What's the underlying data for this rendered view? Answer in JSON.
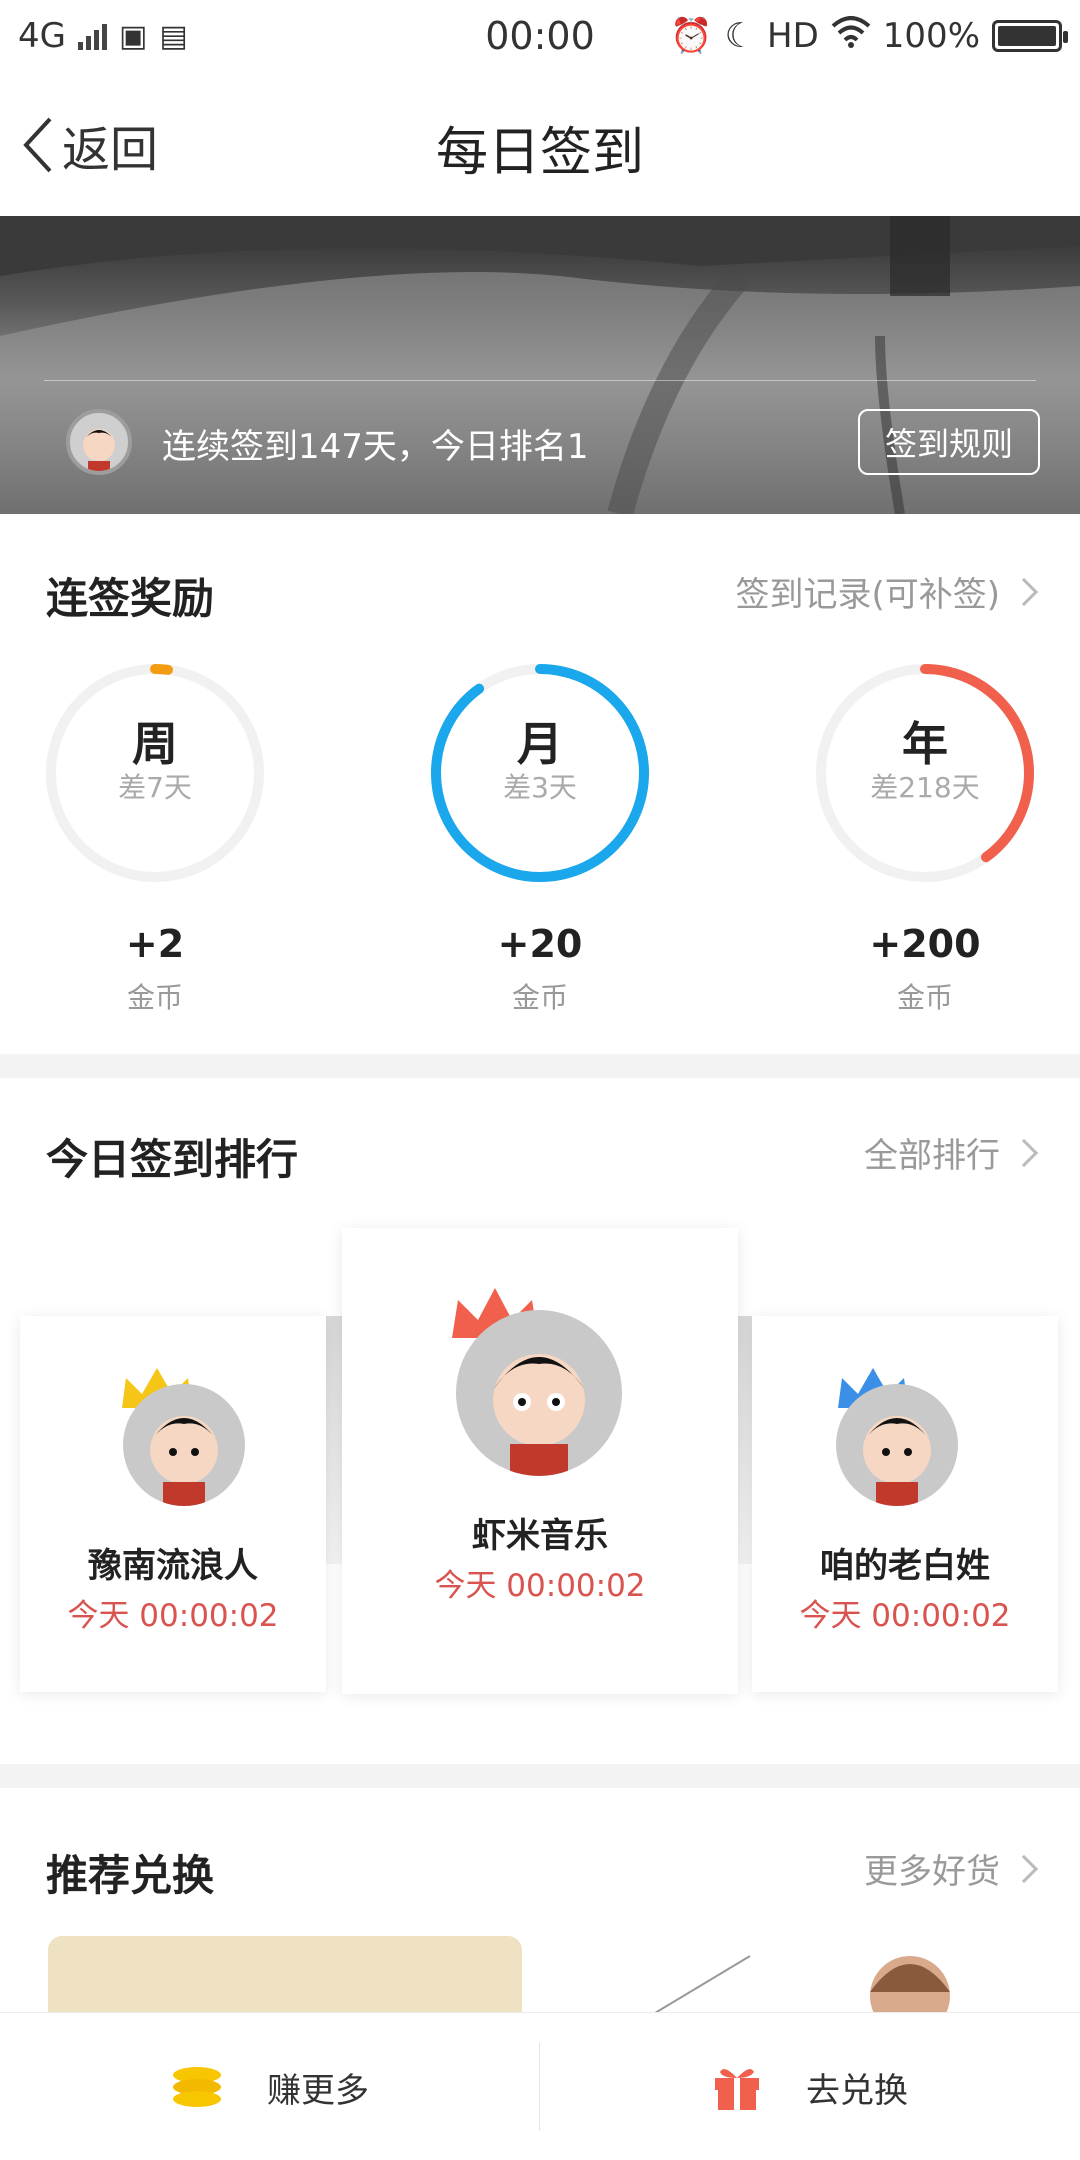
{
  "status_bar": {
    "network": "4G",
    "time": "00:00",
    "hd": "HD",
    "battery": "100%",
    "battery_level": 1.0
  },
  "nav": {
    "back_label": "返回",
    "title": "每日签到"
  },
  "banner": {
    "streak_text": "连续签到147天，今日排名1",
    "rules_button": "签到规则"
  },
  "rewards": {
    "title": "连签奖励",
    "link": "签到记录(可补签)",
    "items": [
      {
        "period": "周",
        "remaining": "差7天",
        "reward": "+2",
        "unit": "金币",
        "color": "#f39c12",
        "progress": 0.02
      },
      {
        "period": "月",
        "remaining": "差3天",
        "reward": "+20",
        "unit": "金币",
        "color": "#1aa7ec",
        "progress": 0.9
      },
      {
        "period": "年",
        "remaining": "差218天",
        "reward": "+200",
        "unit": "金币",
        "color": "#f0604d",
        "progress": 0.4
      }
    ]
  },
  "ranking": {
    "title": "今日签到排行",
    "link": "全部排行",
    "entries": [
      {
        "name": "豫南流浪人",
        "time": "今天 00:00:02",
        "crown_color": "#f5c518"
      },
      {
        "name": "虾米音乐",
        "time": "今天 00:00:02",
        "crown_color": "#f0604d"
      },
      {
        "name": "咱的老白姓",
        "time": "今天 00:00:02",
        "crown_color": "#3b8fe6"
      }
    ]
  },
  "exchange": {
    "title": "推荐兑换",
    "link": "更多好货"
  },
  "bottom_bar": {
    "earn_more": "赚更多",
    "redeem": "去兑换"
  }
}
